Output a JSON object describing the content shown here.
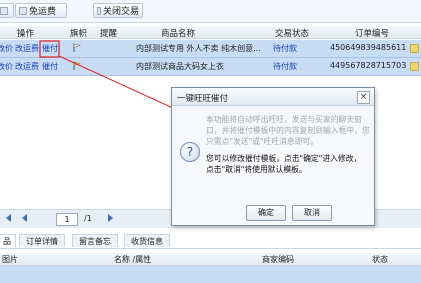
{
  "toolbar": {
    "free_shipping_label": "免运费",
    "close_trade_label": "关闭交易"
  },
  "order_table": {
    "headers": [
      "操作",
      "旗帜",
      "提醒",
      "商品名称",
      "交易状态",
      "订单编号"
    ],
    "rows": [
      {
        "action_partial": "改价",
        "action_change_fee": "改运费",
        "action_urge": "催付",
        "product": "内部测试专用 外人不卖 纯木创意...",
        "status": "待付款",
        "order_no": "450649839485611"
      },
      {
        "action_partial": "改价",
        "action_change_fee": "改运费",
        "action_urge": "催付",
        "product": "内部测试商品大码女上衣",
        "status": "待付款",
        "order_no": "449567828715703"
      }
    ]
  },
  "pager": {
    "current_page": "1",
    "total_pages": "/1"
  },
  "detail_tabs": [
    "品",
    "订单详情",
    "留言备忘",
    "收货信息"
  ],
  "detail_table": {
    "headers": [
      "图片",
      "名称 /属性",
      "商家编码",
      "状态"
    ]
  },
  "dialog": {
    "title": "一键旺旺催付",
    "close_glyph": "×",
    "faded_text": "本功能将自动呼出旺旺，发送与买家的聊天窗口，并将催付模板中的内容复制到输入框中，您只需点\"发送\"或\"旺旺消息即可。",
    "line1": "您可以修改催付模板，点击\"确定\"进入修改，",
    "line2": "点击\"取消\"将使用默认模板。",
    "ok_label": "确定",
    "cancel_label": "取消",
    "question_glyph": "?"
  },
  "colors": {
    "selected_row": "#c8ddf5",
    "link": "#1a3fbf",
    "annotation": "#e02020"
  }
}
